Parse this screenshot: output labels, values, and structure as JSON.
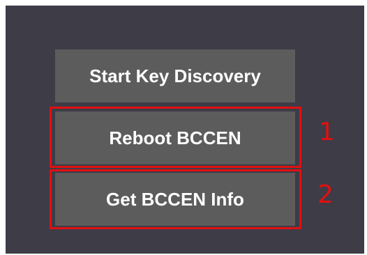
{
  "buttons": {
    "start_key_discovery": "Start Key Discovery",
    "reboot_bccen": "Reboot BCCEN",
    "get_bccen_info": "Get BCCEN Info"
  },
  "annotations": {
    "marker_1": "1",
    "marker_2": "2"
  },
  "colors": {
    "panel_background": "#3d3c47",
    "button_background": "#5c5c5c",
    "button_text": "#ffffff",
    "highlight": "#e01010"
  }
}
